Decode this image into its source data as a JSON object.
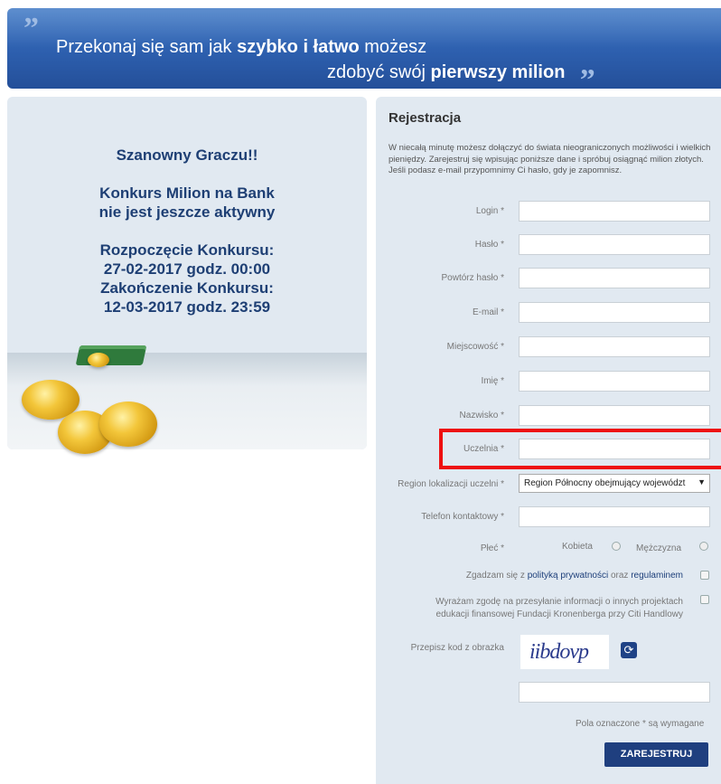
{
  "banner": {
    "line1_pre": "Przekonaj się sam jak ",
    "line1_bold": "szybko i łatwo",
    "line1_post": " możesz",
    "line2_pre": "zdobyć swój ",
    "line2_bold": "pierwszy milion",
    "quote_open": "”",
    "quote_close": "„"
  },
  "notice": {
    "greeting": "Szanowny Graczu!!",
    "status_line1": "Konkurs Milion na Bank",
    "status_line2": "nie jest jeszcze aktywny",
    "start_label": "Rozpoczęcie Konkursu:",
    "start_value": "27-02-2017 godz. 00:00",
    "end_label": "Zakończenie Konkursu:",
    "end_value": "12-03-2017 godz. 23:59"
  },
  "form": {
    "title": "Rejestracja",
    "intro": "W niecałą minutę możesz dołączyć do świata nieograniczonych możliwości i wielkich pieniędzy. Zarejestruj się wpisując poniższe dane i spróbuj osiągnąć milion złotych. Jeśli podasz e-mail przypomnimy Ci hasło, gdy je zapomnisz.",
    "fields": [
      {
        "label": "Login *",
        "value": ""
      },
      {
        "label": "Hasło *",
        "value": ""
      },
      {
        "label": "Powtórz hasło *",
        "value": ""
      },
      {
        "label": "E-mail *",
        "value": ""
      },
      {
        "label": "Miejscowość *",
        "value": ""
      },
      {
        "label": "Imię *",
        "value": ""
      },
      {
        "label": "Nazwisko *",
        "value": ""
      },
      {
        "label": "Uczelnia *",
        "value": ""
      }
    ],
    "region_label": "Region lokalizacji uczelni *",
    "region_value": "Region Północny obejmujący województ",
    "phone_label": "Telefon kontaktowy *",
    "gender_label": "Płeć *",
    "gender_female": "Kobieta",
    "gender_male": "Mężczyzna",
    "terms_pre": "Zgadzam się z ",
    "terms_link1": "polityką prywatności",
    "terms_mid": " oraz ",
    "terms_link2": "regulaminem",
    "marketing_line1": "Wyrażam zgodę na przesyłanie informacji o innych projektach",
    "marketing_line2": "edukacji finansowej Fundacji Kronenberga przy Citi Handlowy",
    "captcha_label": "Przepisz kod z obrazka",
    "captcha_text": "iibdovp",
    "required_note": "Pola oznaczone * są wymagane",
    "submit_label": "ZAREJESTRUJ"
  },
  "colors": {
    "banner": "#2d5fae",
    "panel": "#e1e9f1",
    "heading": "#1e3f74",
    "button": "#1f3f7f",
    "highlight": "#ee1111"
  }
}
